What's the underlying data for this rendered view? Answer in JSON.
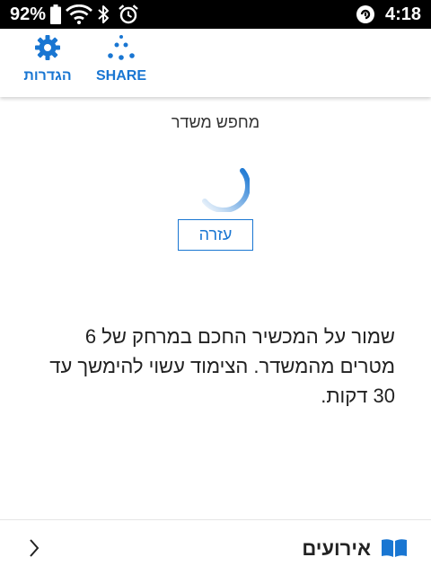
{
  "status_bar": {
    "battery_percent": "92%",
    "time": "4:18",
    "icons": [
      "battery-icon",
      "wifi-icon",
      "bluetooth-icon",
      "alarm-icon",
      "data-saver-icon"
    ]
  },
  "toolbar": {
    "settings_label": "הגדרות",
    "share_label": "SHARE",
    "accent_color": "#1976d2"
  },
  "main": {
    "title": "מחפש משדר",
    "help_label": "עזרה",
    "info_text": "שמור על המכשיר החכם במרחק של 6 מטרים מהמשדר. הצימוד עשוי להימשך עד 30 דקות."
  },
  "bottom_bar": {
    "events_label": "אירועים"
  }
}
